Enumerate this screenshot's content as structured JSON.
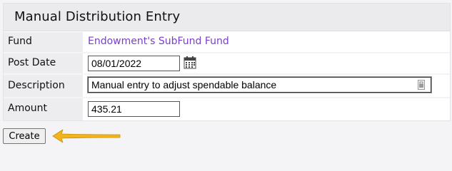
{
  "panel": {
    "title": "Manual Distribution Entry"
  },
  "form": {
    "fund": {
      "label": "Fund",
      "value": "Endowment's SubFund Fund"
    },
    "post_date": {
      "label": "Post Date",
      "value": "08/01/2022"
    },
    "description": {
      "label": "Description",
      "value": "Manual entry to adjust spendable balance"
    },
    "amount": {
      "label": "Amount",
      "value": "435.21"
    }
  },
  "actions": {
    "create_label": "Create"
  },
  "colors": {
    "link": "#7a3fc8",
    "arrow": "#f2b31c",
    "label_bg": "#ededf0",
    "header_bg": "#ebebee"
  },
  "icons": {
    "calendar": "calendar-icon",
    "description_side": "password-manager-icon",
    "annotation": "arrow-left-icon"
  }
}
